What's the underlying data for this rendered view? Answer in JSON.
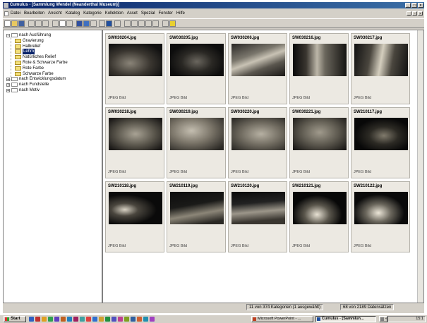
{
  "window": {
    "title": "Cumulus - [Sammlung Wendel (Neanderthal Museum)]"
  },
  "menubar": [
    "Datei",
    "Bearbeiten",
    "Ansicht",
    "Katalog",
    "Kategorie",
    "Kollektion",
    "Asset",
    "Spezial",
    "Fenster",
    "Hilfe"
  ],
  "tree": [
    {
      "label": "nach Ausführung",
      "level": 0,
      "expander": "-"
    },
    {
      "label": "Gravierung",
      "level": 1
    },
    {
      "label": "Halbrelief",
      "level": 1
    },
    {
      "label": "Lehm",
      "level": 1,
      "selected": true
    },
    {
      "label": "Natürliches  Relief",
      "level": 1
    },
    {
      "label": "Rote & Schwarze Farbe",
      "level": 1
    },
    {
      "label": "Rote Farbe",
      "level": 1
    },
    {
      "label": "Schwarze Farbe",
      "level": 1
    },
    {
      "label": "nach Entwicklungsdatum",
      "level": 0,
      "expander": "+"
    },
    {
      "label": "nach Fundstelle",
      "level": 0,
      "expander": "+"
    },
    {
      "label": "nach Motiv",
      "level": 0,
      "expander": "+"
    }
  ],
  "assets": [
    {
      "name": "SW030204.jpg",
      "type": "JPEG Bild"
    },
    {
      "name": "SW030205.jpg",
      "type": "JPEG Bild"
    },
    {
      "name": "SW030206.jpg",
      "type": "JPEG Bild"
    },
    {
      "name": "SW030216.jpg",
      "type": "JPEG Bild"
    },
    {
      "name": "SW030217.jpg",
      "type": "JPEG Bild"
    },
    {
      "name": "SW030218.jpg",
      "type": "JPEG Bild"
    },
    {
      "name": "SW030219.jpg",
      "type": "JPEG Bild"
    },
    {
      "name": "SW030220.jpg",
      "type": "JPEG Bild"
    },
    {
      "name": "SW030221.jpg",
      "type": "JPEG Bild"
    },
    {
      "name": "SW210117.jpg",
      "type": "JPEG Bild"
    },
    {
      "name": "SW210118.jpg",
      "type": "JPEG Bild"
    },
    {
      "name": "SW210119.jpg",
      "type": "JPEG Bild"
    },
    {
      "name": "SW210120.jpg",
      "type": "JPEG Bild"
    },
    {
      "name": "SW210121.jpg",
      "type": "JPEG Bild"
    },
    {
      "name": "SW210122.jpg",
      "type": "JPEG Bild"
    }
  ],
  "status": {
    "categories": "11 von 374 Kategorien (1 ausgewählt)",
    "records": "68 von 2189 Datensätzen"
  },
  "taskbar": {
    "start": "Start",
    "tasks": [
      "Microsoft PowerPoint - ...",
      "Cumulus - [Sammlun...",
      "«"
    ],
    "clock": "15:1"
  }
}
